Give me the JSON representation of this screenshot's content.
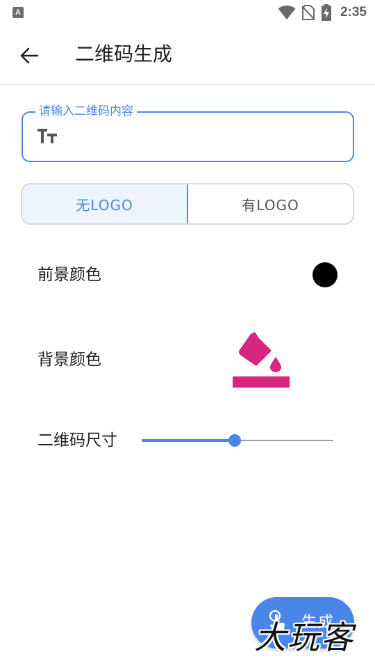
{
  "status_bar": {
    "app_icon_letter": "A",
    "time": "2:35",
    "icons": [
      "app-notification-icon",
      "wifi-icon",
      "no-sim-icon",
      "battery-charging-icon"
    ]
  },
  "app_bar": {
    "back_icon": "arrow-left-icon",
    "title": "二维码生成"
  },
  "qr_input": {
    "label": "请输入二维码内容",
    "value": "",
    "icon": "text-size-icon"
  },
  "logo_toggle": {
    "options": [
      {
        "label": "无LOGO",
        "selected": true
      },
      {
        "label": "有LOGO",
        "selected": false
      }
    ]
  },
  "foreground": {
    "label": "前景颜色",
    "color": "#000000"
  },
  "background": {
    "label": "背景颜色",
    "icon": "color-fill-icon",
    "icon_color": "#d6267e"
  },
  "qr_size": {
    "label": "二维码尺寸",
    "slider_fraction": 0.485
  },
  "generate_button": {
    "label": "生成",
    "icon": "touch-icon"
  },
  "watermark": {
    "text": "大玩客"
  },
  "colors": {
    "accent": "#4a86e8",
    "fill_icon": "#d6267e"
  }
}
